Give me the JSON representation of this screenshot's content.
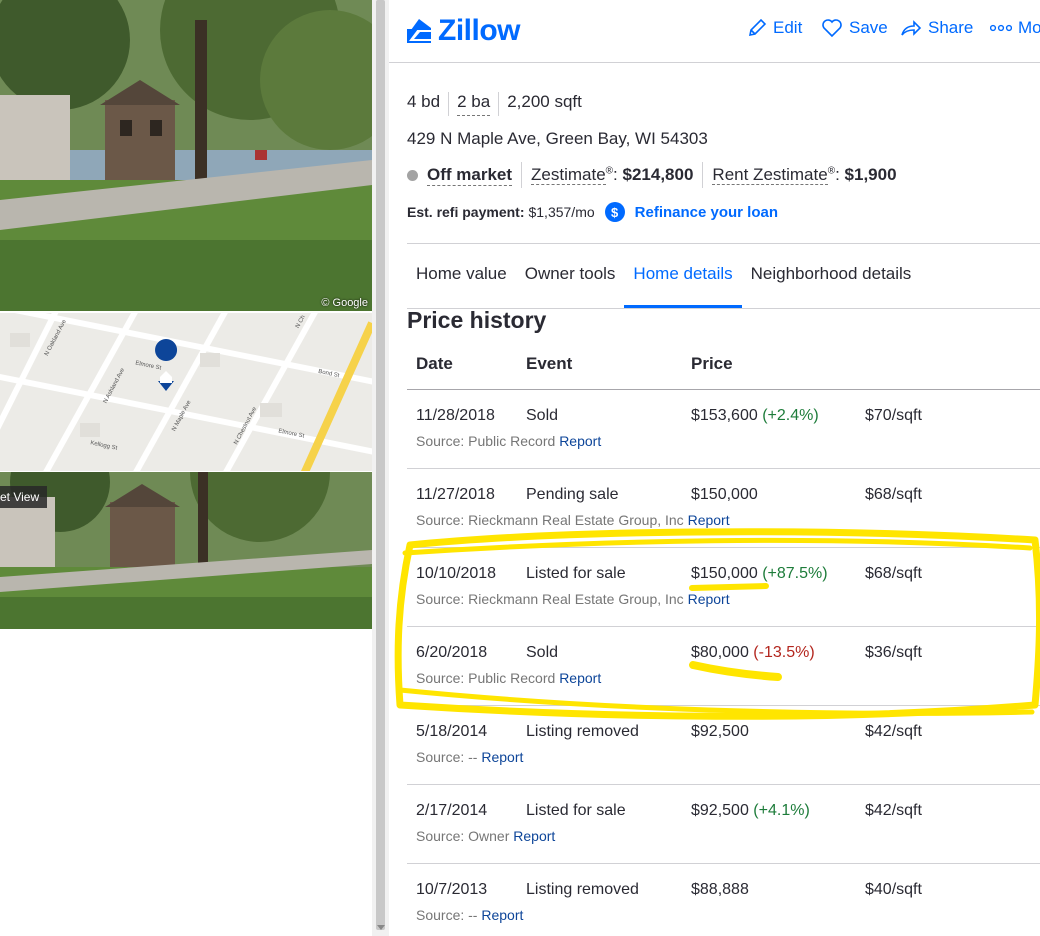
{
  "brand": {
    "name": "Zillow",
    "color": "#006aff"
  },
  "media": {
    "google_mark": "© Google",
    "street_view_tag": "et View",
    "map_streets": [
      "N Oakland Ave",
      "N Ashland Ave",
      "Elmore St",
      "N Maple Ave",
      "Kellogg St",
      "N Chestnut Ave",
      "Elmore St",
      "Bond St",
      "N Ch"
    ]
  },
  "actions": {
    "edit": "Edit",
    "save": "Save",
    "share": "Share",
    "more": "Mo"
  },
  "facts": {
    "beds": "4 bd",
    "baths": "2 ba",
    "sqft": "2,200 sqft"
  },
  "address": "429 N Maple Ave, Green Bay, WI 54303",
  "status": {
    "label": "Off market",
    "zestimate_label": "Zestimate",
    "zestimate_value": "$214,800",
    "rent_label": "Rent Zestimate",
    "rent_value": "$1,900",
    "reg": "®",
    "colon": ":"
  },
  "refi": {
    "label": "Est. refi payment:",
    "amount": "$1,357/mo",
    "icon": "$",
    "link": "Refinance your loan"
  },
  "tabs": [
    {
      "label": "Home value",
      "active": false
    },
    {
      "label": "Owner tools",
      "active": false
    },
    {
      "label": "Home details",
      "active": true
    },
    {
      "label": "Neighborhood details",
      "active": false
    }
  ],
  "price_history": {
    "title": "Price history",
    "headers": {
      "date": "Date",
      "event": "Event",
      "price": "Price"
    },
    "rows": [
      {
        "date": "11/28/2018",
        "event": "Sold",
        "price": "$153,600",
        "change": "(+2.4%)",
        "dir": "pos",
        "sqft": "$70/sqft",
        "source": "Source: Public Record",
        "report": "Report"
      },
      {
        "date": "11/27/2018",
        "event": "Pending sale",
        "price": "$150,000",
        "change": "",
        "dir": "",
        "sqft": "$68/sqft",
        "source": "Source: Rieckmann Real Estate Group, Inc",
        "report": "Report"
      },
      {
        "date": "10/10/2018",
        "event": "Listed for sale",
        "price": "$150,000",
        "change": "(+87.5%)",
        "dir": "pos",
        "sqft": "$68/sqft",
        "source": "Source: Rieckmann Real Estate Group, Inc",
        "report": "Report"
      },
      {
        "date": "6/20/2018",
        "event": "Sold",
        "price": "$80,000",
        "change": "(-13.5%)",
        "dir": "neg",
        "sqft": "$36/sqft",
        "source": "Source: Public Record",
        "report": "Report"
      },
      {
        "date": "5/18/2014",
        "event": "Listing removed",
        "price": "$92,500",
        "change": "",
        "dir": "",
        "sqft": "$42/sqft",
        "source": "Source: --",
        "report": "Report"
      },
      {
        "date": "2/17/2014",
        "event": "Listed for sale",
        "price": "$92,500",
        "change": "(+4.1%)",
        "dir": "pos",
        "sqft": "$42/sqft",
        "source": "Source: Owner",
        "report": "Report"
      },
      {
        "date": "10/7/2013",
        "event": "Listing removed",
        "price": "$88,888",
        "change": "",
        "dir": "",
        "sqft": "$40/sqft",
        "source": "Source: --",
        "report": "Report"
      }
    ]
  },
  "annotation": {
    "color": "#ffe500"
  }
}
